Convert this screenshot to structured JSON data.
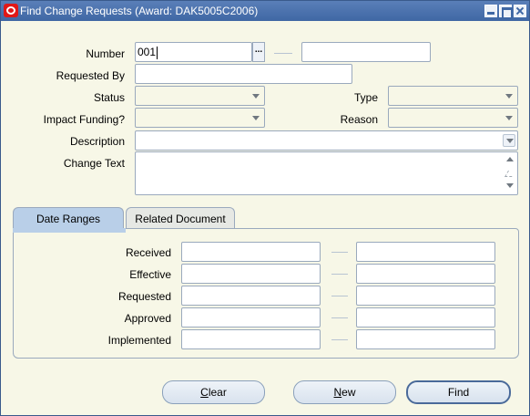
{
  "window": {
    "title": "Find Change Requests (Award: DAK5005C2006)"
  },
  "form": {
    "number_label": "Number",
    "number_from_value": "001",
    "number_lov_label": "...",
    "number_to_value": "",
    "requested_by_label": "Requested By",
    "requested_by_value": "",
    "status_label": "Status",
    "status_value": "",
    "type_label": "Type",
    "type_value": "",
    "impact_funding_label": "Impact Funding?",
    "impact_funding_value": "",
    "reason_label": "Reason",
    "reason_value": "",
    "description_label": "Description",
    "description_value": "",
    "change_text_label": "Change Text",
    "change_text_value": ""
  },
  "tabs": [
    {
      "label": "Date Ranges",
      "active": true
    },
    {
      "label": "Related Document",
      "active": false
    }
  ],
  "date_ranges": {
    "rows": [
      {
        "label": "Received",
        "from": "",
        "to": ""
      },
      {
        "label": "Effective",
        "from": "",
        "to": ""
      },
      {
        "label": "Requested",
        "from": "",
        "to": ""
      },
      {
        "label": "Approved",
        "from": "",
        "to": ""
      },
      {
        "label": "Implemented",
        "from": "",
        "to": ""
      }
    ]
  },
  "buttons": {
    "clear": {
      "mnemonic": "C",
      "rest": "lear"
    },
    "new": {
      "mnemonic": "N",
      "rest": "ew"
    },
    "find": "Find"
  },
  "colors": {
    "window_bg": "#f7f7e7",
    "titlebar": "#3f67a4",
    "active_tab": "#b9cfe8",
    "field_border": "#9aa9bd"
  },
  "icons": {
    "app": "oracle-logo-icon",
    "minimize": "minimize-icon",
    "maximize": "maximize-icon",
    "close": "close-icon"
  }
}
